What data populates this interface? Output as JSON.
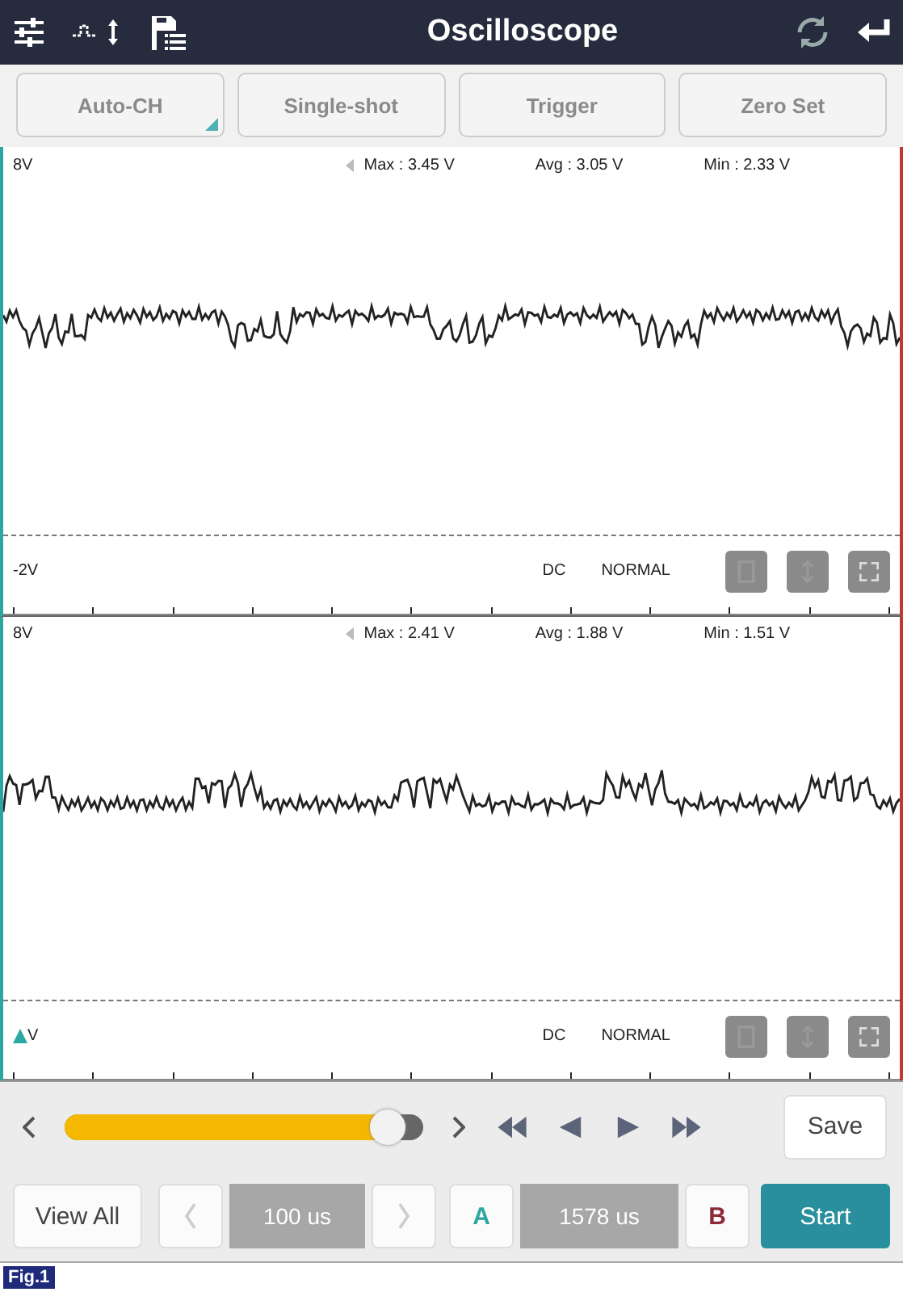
{
  "header": {
    "title": "Oscilloscope"
  },
  "mode_buttons": [
    {
      "label": "Auto-CH",
      "disabled": true,
      "has_menu": true
    },
    {
      "label": "Single-shot",
      "disabled": true,
      "has_menu": false
    },
    {
      "label": "Trigger",
      "disabled": true,
      "has_menu": false
    },
    {
      "label": "Zero Set",
      "disabled": true,
      "has_menu": false
    }
  ],
  "channels": [
    {
      "scale_max": "8V",
      "max": "Max : 3.45 V",
      "avg": "Avg : 3.05 V",
      "min": "Min : 2.33 V",
      "scale_min": "-2V",
      "coupling": "DC",
      "mode": "NORMAL",
      "marker": false
    },
    {
      "scale_max": "8V",
      "max": "Max : 2.41 V",
      "avg": "Avg : 1.88 V",
      "min": "Min : 1.51 V",
      "scale_min": "V",
      "coupling": "DC",
      "mode": "NORMAL",
      "marker": true
    }
  ],
  "playback": {
    "level": 0.9,
    "save": "Save"
  },
  "bottom": {
    "view_all": "View All",
    "timebase": "100 us",
    "a": "A",
    "cursor": "1578 us",
    "b": "B",
    "start": "Start"
  },
  "figure_label": "Fig.1"
}
